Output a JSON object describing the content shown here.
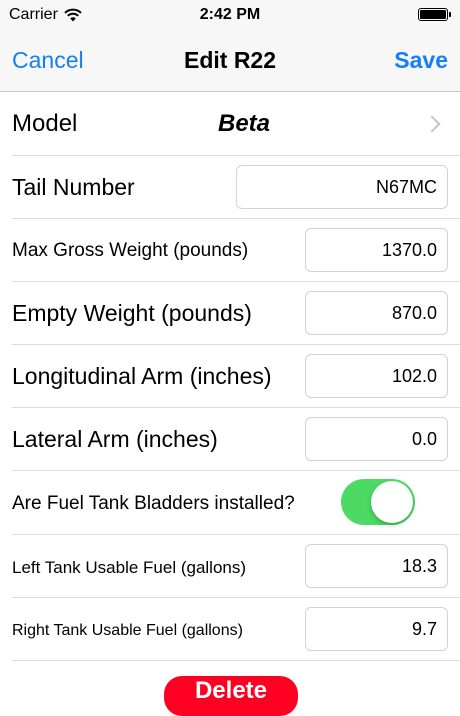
{
  "status_bar": {
    "carrier": "Carrier",
    "time": "2:42 PM"
  },
  "nav": {
    "cancel_label": "Cancel",
    "title": "Edit R22",
    "save_label": "Save"
  },
  "form": {
    "model": {
      "label": "Model",
      "value": "Beta"
    },
    "tail_number": {
      "label": "Tail Number",
      "value": "N67MC"
    },
    "max_gross_weight": {
      "label": "Max Gross Weight (pounds)",
      "value": "1370.0"
    },
    "empty_weight": {
      "label": "Empty Weight (pounds)",
      "value": "870.0"
    },
    "longitudinal_arm": {
      "label": "Longitudinal Arm (inches)",
      "value": "102.0"
    },
    "lateral_arm": {
      "label": "Lateral Arm (inches)",
      "value": "0.0"
    },
    "fuel_bladders": {
      "label": "Are Fuel Tank Bladders installed?",
      "on": true
    },
    "left_tank": {
      "label": "Left Tank Usable Fuel (gallons)",
      "value": "18.3"
    },
    "right_tank": {
      "label": "Right Tank Usable Fuel (gallons)",
      "value": "9.7"
    }
  },
  "delete_label": "Delete",
  "colors": {
    "accent": "#147efb",
    "toggle_on": "#4cd964",
    "destructive": "#ff0022"
  },
  "icons": [
    "wifi-icon",
    "battery-icon",
    "chevron-right-icon"
  ]
}
